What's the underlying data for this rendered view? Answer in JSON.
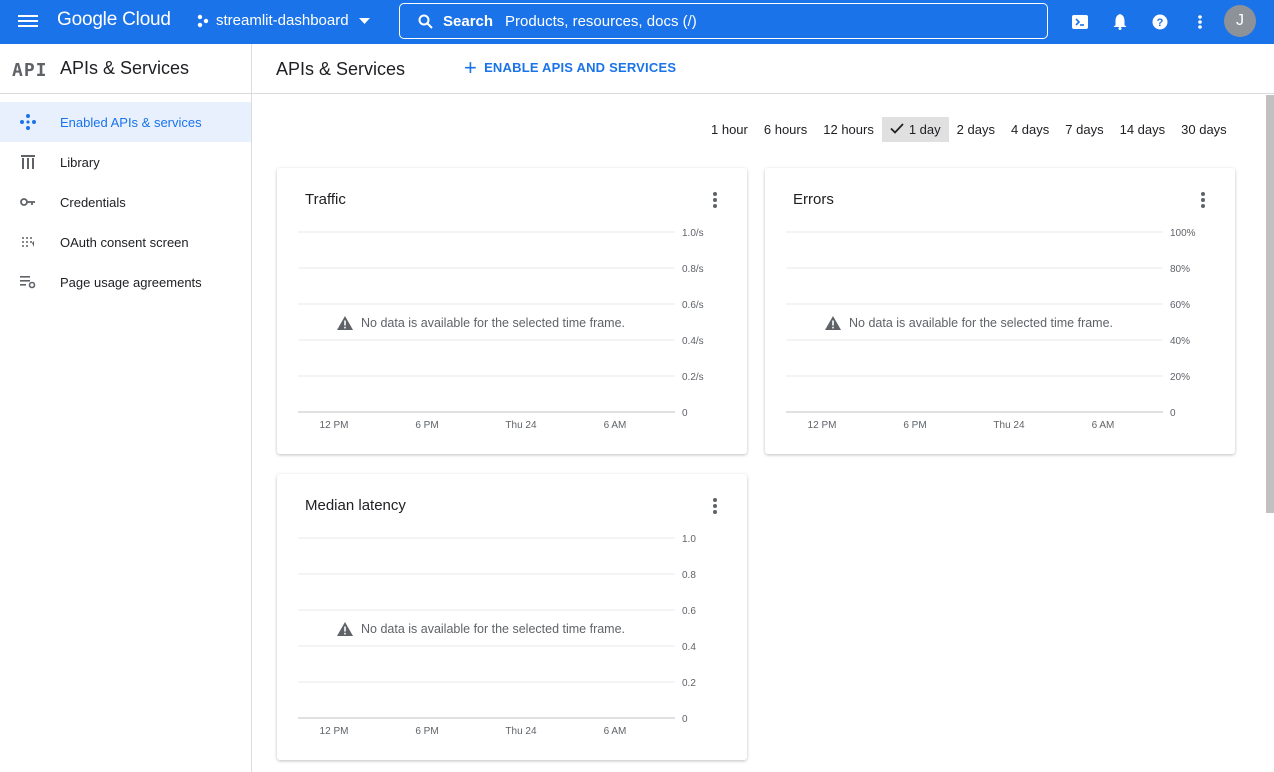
{
  "topbar": {
    "logo": "Google Cloud",
    "project": "streamlit-dashboard",
    "search_label": "Search",
    "search_placeholder": "Products, resources, docs (/)",
    "avatar_initial": "J"
  },
  "sidebar": {
    "logo": "API",
    "title": "APIs & Services",
    "items": [
      {
        "label": "Enabled APIs & services",
        "active": true
      },
      {
        "label": "Library"
      },
      {
        "label": "Credentials"
      },
      {
        "label": "OAuth consent screen"
      },
      {
        "label": "Page usage agreements"
      }
    ]
  },
  "main": {
    "title": "APIs & Services",
    "enable_button": "ENABLE APIS AND SERVICES"
  },
  "time_range": {
    "options": [
      "1 hour",
      "6 hours",
      "12 hours",
      "1 day",
      "2 days",
      "4 days",
      "7 days",
      "14 days",
      "30 days"
    ],
    "selected": "1 day"
  },
  "charts": [
    {
      "title": "Traffic",
      "no_data": "No data is available for the selected time frame."
    },
    {
      "title": "Errors",
      "no_data": "No data is available for the selected time frame."
    },
    {
      "title": "Median latency",
      "no_data": "No data is available for the selected time frame."
    }
  ],
  "chart_data": [
    {
      "type": "line",
      "title": "Traffic",
      "x_ticks": [
        "12 PM",
        "6 PM",
        "Thu 24",
        "6 AM"
      ],
      "y_ticks": [
        "1.0/s",
        "0.8/s",
        "0.6/s",
        "0.4/s",
        "0.2/s",
        "0"
      ],
      "ylim": [
        0,
        1.0
      ],
      "series": []
    },
    {
      "type": "line",
      "title": "Errors",
      "x_ticks": [
        "12 PM",
        "6 PM",
        "Thu 24",
        "6 AM"
      ],
      "y_ticks": [
        "100%",
        "80%",
        "60%",
        "40%",
        "20%",
        "0"
      ],
      "ylim": [
        0,
        100
      ],
      "series": []
    },
    {
      "type": "line",
      "title": "Median latency",
      "x_ticks": [
        "12 PM",
        "6 PM",
        "Thu 24",
        "6 AM"
      ],
      "y_ticks": [
        "1.0",
        "0.8",
        "0.6",
        "0.4",
        "0.2",
        "0"
      ],
      "ylim": [
        0,
        1.0
      ],
      "series": []
    }
  ]
}
